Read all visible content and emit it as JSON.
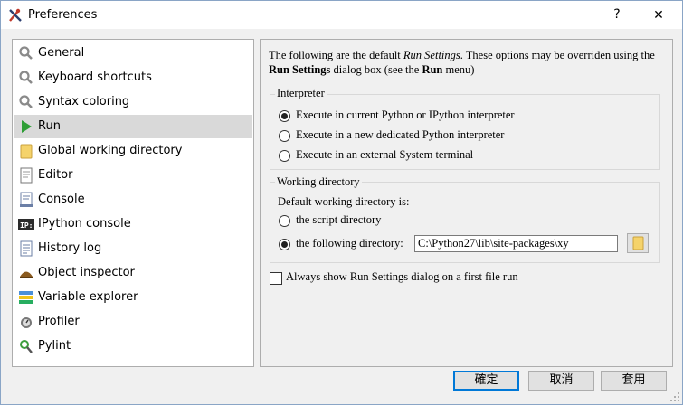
{
  "window": {
    "title": "Preferences",
    "help_glyph": "?",
    "close_glyph": "✕"
  },
  "sidebar": {
    "items": [
      {
        "label": "General",
        "icon": "wrench-icon"
      },
      {
        "label": "Keyboard shortcuts",
        "icon": "wrench-icon"
      },
      {
        "label": "Syntax coloring",
        "icon": "wrench-icon"
      },
      {
        "label": "Run",
        "icon": "run-arrow-icon",
        "selected": true
      },
      {
        "label": "Global working directory",
        "icon": "folder-icon"
      },
      {
        "label": "Editor",
        "icon": "editor-icon"
      },
      {
        "label": "Console",
        "icon": "console-icon"
      },
      {
        "label": "IPython console",
        "icon": "ipython-icon"
      },
      {
        "label": "History log",
        "icon": "history-icon"
      },
      {
        "label": "Object inspector",
        "icon": "inspector-icon"
      },
      {
        "label": "Variable explorer",
        "icon": "variable-explorer-icon"
      },
      {
        "label": "Profiler",
        "icon": "profiler-icon"
      },
      {
        "label": "Pylint",
        "icon": "pylint-icon"
      }
    ]
  },
  "content": {
    "desc_1": "The following are the default ",
    "desc_italic": "Run Settings",
    "desc_2": ". These options may be overriden using the ",
    "desc_bold_1": "Run Settings",
    "desc_3": " dialog box (see the ",
    "desc_bold_2": "Run",
    "desc_4": " menu)",
    "interpreter": {
      "title": "Interpreter",
      "options": [
        {
          "label": "Execute in current Python or IPython interpreter",
          "checked": true
        },
        {
          "label": "Execute in a new dedicated Python interpreter",
          "checked": false
        },
        {
          "label": "Execute in an external System terminal",
          "checked": false
        }
      ]
    },
    "workdir": {
      "title": "Working directory",
      "default_label": "Default working directory is:",
      "script_dir_label": "the script directory",
      "following_dir_label": "the following directory:",
      "path_value": "C:\\Python27\\lib\\site-packages\\xy",
      "selected": "following"
    },
    "always_show_label": "Always show Run Settings dialog on a first file run",
    "always_show_checked": false
  },
  "buttons": {
    "ok": "確定",
    "cancel": "取消",
    "apply": "套用"
  },
  "colors": {
    "accent": "#0078d7",
    "run_arrow": "#2e9e36",
    "folder": "#f5d36b"
  }
}
